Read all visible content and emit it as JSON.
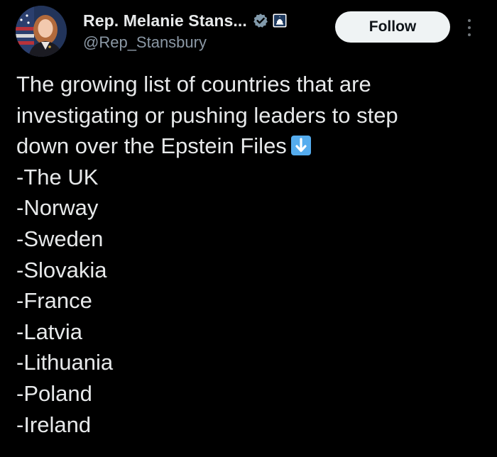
{
  "author": {
    "display_name": "Rep. Melanie Stans...",
    "handle": "@Rep_Stansbury",
    "avatar_icon": "profile-photo",
    "badges": [
      "verified-check-icon",
      "government-capitol-icon"
    ]
  },
  "actions": {
    "follow_label": "Follow",
    "more_icon": "more-vertical-icon"
  },
  "tweet": {
    "intro_lines": [
      "The growing list of countries that are",
      "investigating or pushing leaders to step",
      "down over the Epstein Files"
    ],
    "intro_emoji": "down-arrow-emoji",
    "countries": [
      "-The UK",
      "-Norway",
      "-Sweden",
      "-Slovakia",
      "-France",
      "-Latvia",
      "-Lithuania",
      "-Poland",
      "-Ireland"
    ]
  },
  "colors": {
    "background": "#000000",
    "text": "#e7e9ea",
    "secondary_text": "#8b98a5",
    "follow_bg": "#eff3f4",
    "verified_badge": "#829aab"
  }
}
